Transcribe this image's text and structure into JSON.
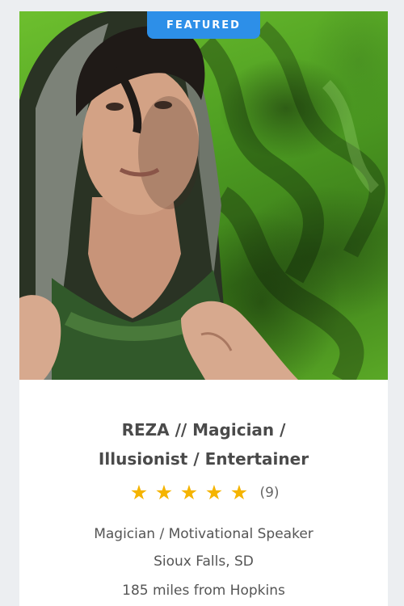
{
  "listing": {
    "badge": "FEATURED",
    "title_line1": "REZA // Magician /",
    "title_line2": "Illusionist / Entertainer",
    "rating": {
      "stars": 5,
      "max_stars": 5,
      "count": "(9)"
    },
    "category": "Magician / Motivational Speaker",
    "location": "Sioux Falls, SD",
    "distance": "185 miles from Hopkins"
  },
  "colors": {
    "badge_bg": "#2d8fe8",
    "star": "#f5b400",
    "photo_bg": "#5aa826"
  },
  "icons": {
    "star": "star-icon"
  }
}
